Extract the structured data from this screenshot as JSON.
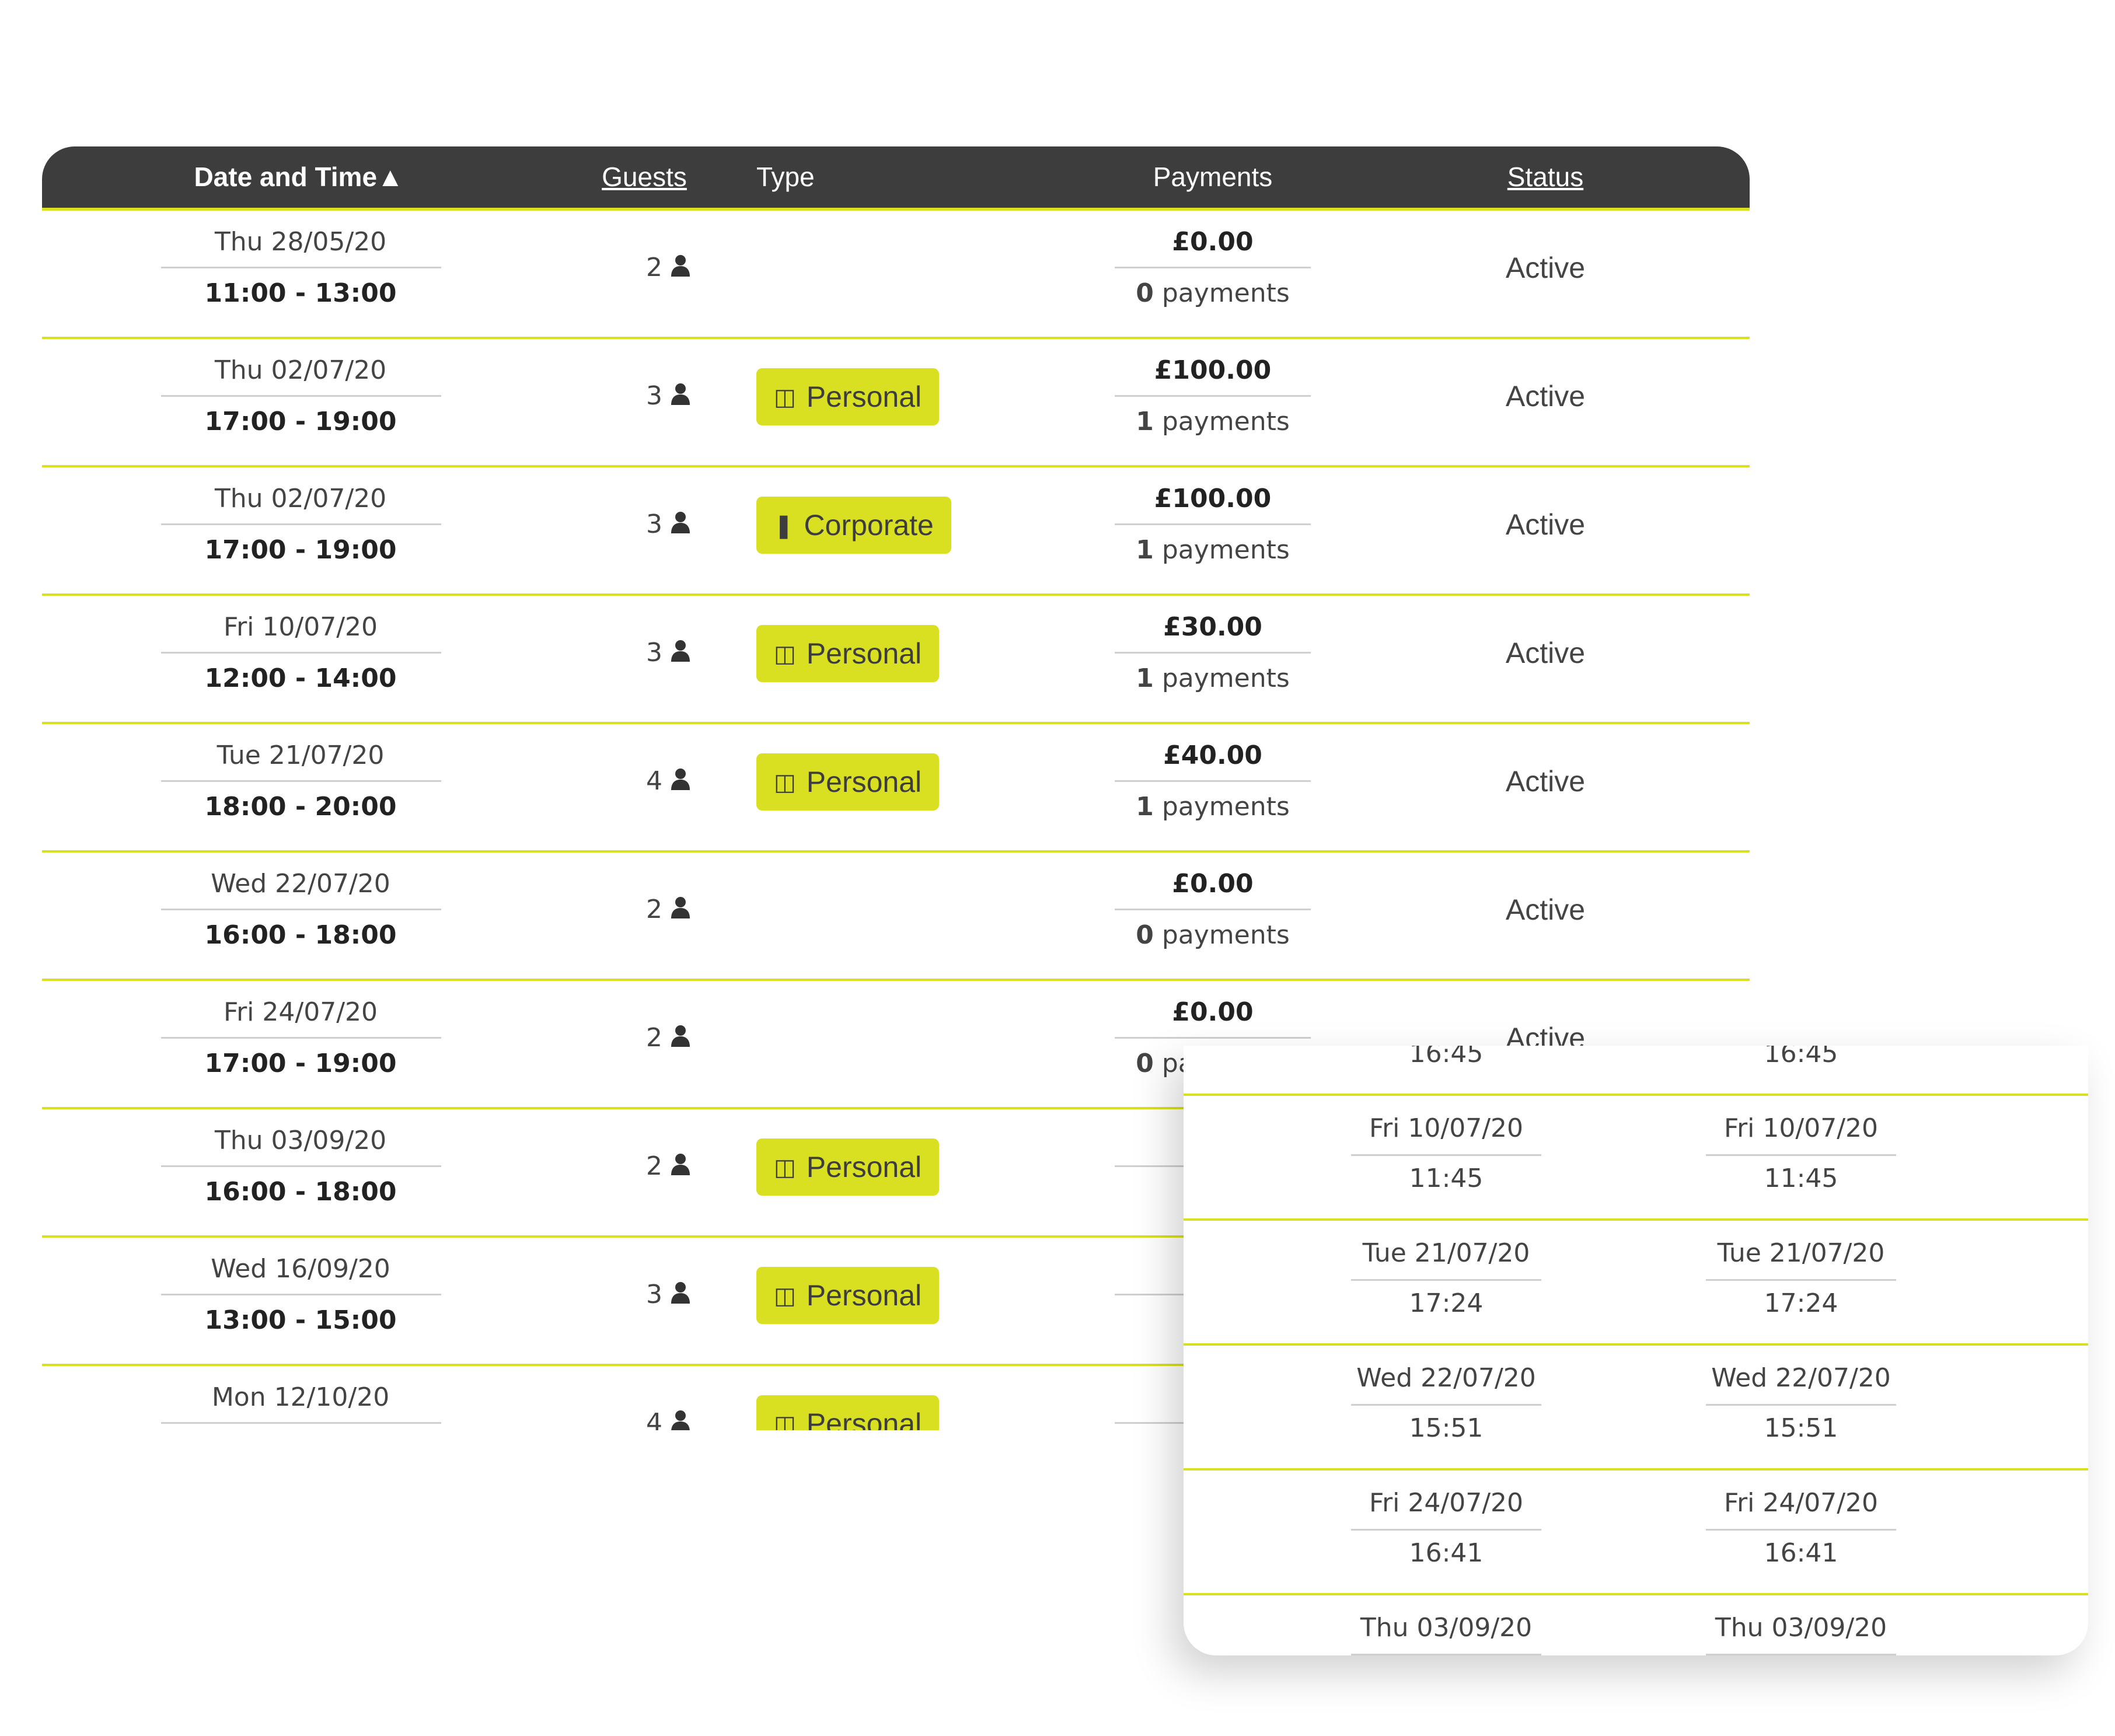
{
  "header": {
    "date_time": "Date and Time▲",
    "guests": "Guests",
    "type": "Type",
    "payments": "Payments",
    "status": "Status"
  },
  "rows": [
    {
      "date": "Thu 28/05/20",
      "time": "11:00 - 13:00",
      "guests": "2",
      "type": "",
      "type_icon": "",
      "amount": "£0.00",
      "payments_count": "0",
      "payments_label": "payments",
      "status": "Active"
    },
    {
      "date": "Thu 02/07/20",
      "time": "17:00 - 19:00",
      "guests": "3",
      "type": "Personal",
      "type_icon": "beer-mug-icon",
      "amount": "£100.00",
      "payments_count": "1",
      "payments_label": "payments",
      "status": "Active"
    },
    {
      "date": "Thu 02/07/20",
      "time": "17:00 - 19:00",
      "guests": "3",
      "type": "Corporate",
      "type_icon": "tie-icon",
      "amount": "£100.00",
      "payments_count": "1",
      "payments_label": "payments",
      "status": "Active"
    },
    {
      "date": "Fri 10/07/20",
      "time": "12:00 - 14:00",
      "guests": "3",
      "type": "Personal",
      "type_icon": "beer-mug-icon",
      "amount": "£30.00",
      "payments_count": "1",
      "payments_label": "payments",
      "status": "Active"
    },
    {
      "date": "Tue 21/07/20",
      "time": "18:00 - 20:00",
      "guests": "4",
      "type": "Personal",
      "type_icon": "beer-mug-icon",
      "amount": "£40.00",
      "payments_count": "1",
      "payments_label": "payments",
      "status": "Active"
    },
    {
      "date": "Wed 22/07/20",
      "time": "16:00 - 18:00",
      "guests": "2",
      "type": "",
      "type_icon": "",
      "amount": "£0.00",
      "payments_count": "0",
      "payments_label": "payments",
      "status": "Active"
    },
    {
      "date": "Fri 24/07/20",
      "time": "17:00 - 19:00",
      "guests": "2",
      "type": "",
      "type_icon": "",
      "amount": "£0.00",
      "payments_count": "0",
      "payments_label": "payments",
      "status": "Active"
    },
    {
      "date": "Thu 03/09/20",
      "time": "16:00 - 18:00",
      "guests": "2",
      "type": "Personal",
      "type_icon": "beer-mug-icon",
      "amount": "£",
      "payments_count": "1",
      "payments_label": "p",
      "status": ""
    },
    {
      "date": "Wed 16/09/20",
      "time": "13:00 - 15:00",
      "guests": "3",
      "type": "Personal",
      "type_icon": "beer-mug-icon",
      "amount": "£",
      "payments_count": "1",
      "payments_label": "p",
      "status": ""
    },
    {
      "date": "Mon 12/10/20",
      "time": "",
      "guests": "4",
      "type": "Personal",
      "type_icon": "beer-mug-icon",
      "amount": "",
      "payments_count": "",
      "payments_label": "",
      "status": ""
    }
  ],
  "front_card": {
    "partial_top": [
      "16:45",
      "16:45"
    ],
    "rows": [
      {
        "col1_date": "Fri 10/07/20",
        "col1_time": "11:45",
        "col2_date": "Fri 10/07/20",
        "col2_time": "11:45"
      },
      {
        "col1_date": "Tue 21/07/20",
        "col1_time": "17:24",
        "col2_date": "Tue 21/07/20",
        "col2_time": "17:24"
      },
      {
        "col1_date": "Wed 22/07/20",
        "col1_time": "15:51",
        "col2_date": "Wed 22/07/20",
        "col2_time": "15:51"
      },
      {
        "col1_date": "Fri 24/07/20",
        "col1_time": "16:41",
        "col2_date": "Fri 24/07/20",
        "col2_time": "16:41"
      },
      {
        "col1_date": "Thu 03/09/20",
        "col1_time": "",
        "col2_date": "Thu 03/09/20",
        "col2_time": ""
      }
    ]
  },
  "colors": {
    "header_bg": "#3d3d3e",
    "accent": "#d9e021",
    "divider": "#cfcfcf"
  }
}
